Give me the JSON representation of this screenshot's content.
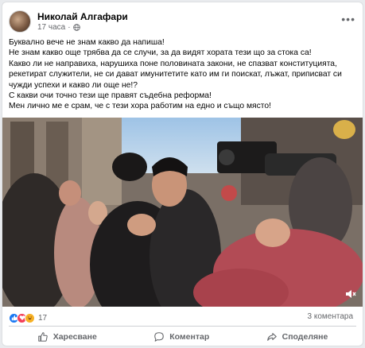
{
  "post": {
    "author": "Николай Алгафари",
    "time": "17 часа",
    "text": [
      "Буквално вече не знам какво да напиша!",
      "Не знам какво още трябва да се случи, за да видят хората тези що за стока са!",
      "Какво ли не направиха, нарушиха поне половината закони, не спазват конституцията, рекетират служители, не си дават имунитетите като им ги поискат, лъжат, приписват си чужди успехи и какво ли още не!?",
      "С какви очи точно тези ще правят съдебна реформа!",
      "Мен лично ме е срам, че с тези хора работим на едно и също място!"
    ]
  },
  "reactions": {
    "count": "17",
    "types": [
      "like",
      "love",
      "haha"
    ]
  },
  "comments": {
    "count_label": "3 коментара"
  },
  "actions": {
    "like_label": "Харесване",
    "comment_label": "Коментар",
    "share_label": "Споделяне"
  },
  "icons": {
    "more": "more-options-icon",
    "privacy": "globe-icon",
    "volume": "volume-icon"
  },
  "colors": {
    "like": "#1877f2",
    "love": "#f33e58",
    "haha": "#f7b125",
    "secondary_text": "#65676b"
  }
}
